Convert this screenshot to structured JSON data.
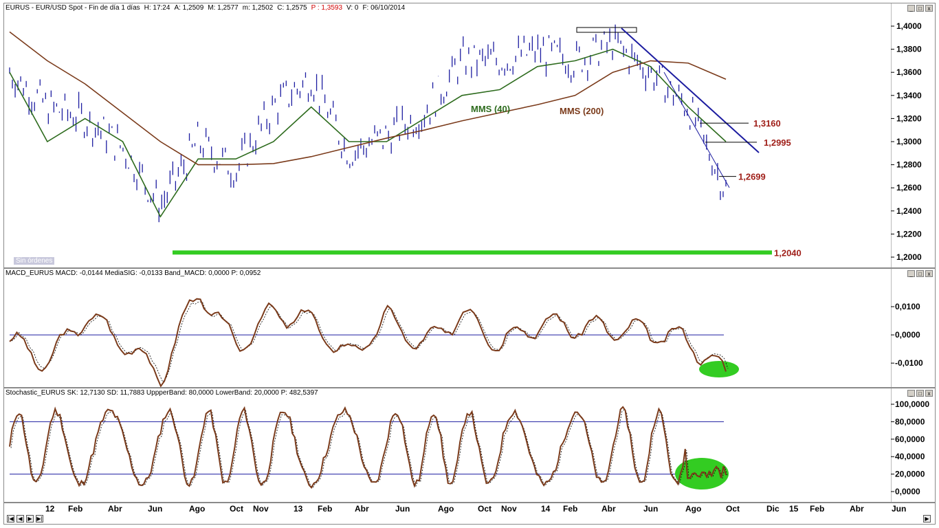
{
  "price_panel": {
    "header": [
      "EURUS - EUR/USD Spot - Fin de día 1 días",
      "H: 17:24",
      "A: 1,2509",
      "M: 1,2577",
      "m: 1,2502",
      "C: 1,2575"
    ],
    "header_p": "P : 1,3593",
    "header_tail": [
      "V: 0",
      "F: 06/10/2014"
    ],
    "labels": {
      "mms40": "MMS (40)",
      "mms200": "MMS (200)",
      "l1316": "1,3160",
      "l12995": "1,2995",
      "l12699": "1,2699",
      "l12040": "1,2040"
    },
    "status": "Sin órdenes",
    "yticks": [
      "1,4000",
      "1,3800",
      "1,3600",
      "1,3400",
      "1,3200",
      "1,3000",
      "1,2800",
      "1,2600",
      "1,2400",
      "1,2200",
      "1,2000"
    ]
  },
  "macd_panel": {
    "header": "MACD_EURUS  MACD: -0,0144  MediaSIG: -0,0133  Band_MACD: 0,0000  P: 0,0952",
    "yticks": [
      "0,0100",
      "0,0000",
      "-0,0100"
    ]
  },
  "stoch_panel": {
    "header": "Stochastic_EURUS  SK: 12,7130  SD: 11,7883  UppperBand: 80,0000  LowerBand: 20,0000  P: 482,5397",
    "yticks": [
      "100,0000",
      "80,0000",
      "60,0000",
      "40,0000",
      "20,0000",
      "0,0000"
    ]
  },
  "time_axis": [
    "12",
    "Feb",
    "Abr",
    "Jun",
    "Ago",
    "Oct",
    "Nov",
    "13",
    "Feb",
    "Abr",
    "Jun",
    "Ago",
    "Oct",
    "Nov",
    "14",
    "Feb",
    "Abr",
    "Jun",
    "Ago",
    "Oct",
    "Dic",
    "15",
    "Feb",
    "Abr",
    "Jun"
  ],
  "colors": {
    "price": "#1c1ca0",
    "mms40": "#2d6b1d",
    "mms200": "#7a3a1a",
    "macd": "#7a3a1a",
    "highlight": "#33cc22",
    "level": "#a0201a"
  },
  "chart_data": [
    {
      "type": "line",
      "title": "EURUS - EUR/USD Spot - Fin de día 1 días",
      "x": [
        "2012-01",
        "2012-02",
        "2012-04",
        "2012-06",
        "2012-08",
        "2012-10",
        "2012-11",
        "2013-01",
        "2013-02",
        "2013-04",
        "2013-06",
        "2013-08",
        "2013-10",
        "2013-11",
        "2014-01",
        "2014-02",
        "2014-04",
        "2014-06",
        "2014-08",
        "2014-10"
      ],
      "series": [
        {
          "name": "MMS (40)",
          "values": [
            1.36,
            1.3,
            1.32,
            1.3,
            1.235,
            1.285,
            1.285,
            1.3,
            1.33,
            1.3,
            1.3,
            1.32,
            1.34,
            1.345,
            1.365,
            1.37,
            1.38,
            1.365,
            1.33,
            1.3
          ]
        },
        {
          "name": "MMS (200)",
          "values": [
            1.395,
            1.37,
            1.35,
            1.325,
            1.3,
            1.28,
            1.28,
            1.281,
            1.287,
            1.295,
            1.303,
            1.31,
            1.318,
            1.325,
            1.332,
            1.34,
            1.36,
            1.37,
            1.368,
            1.354
          ]
        }
      ],
      "price": [
        1.36,
        1.33,
        1.32,
        1.295,
        1.245,
        1.3,
        1.275,
        1.33,
        1.355,
        1.29,
        1.305,
        1.325,
        1.37,
        1.37,
        1.378,
        1.37,
        1.385,
        1.36,
        1.33,
        1.258
      ],
      "levels": [
        1.316,
        1.2995,
        1.2699,
        1.204
      ],
      "ylim": [
        1.2,
        1.4
      ]
    },
    {
      "type": "line",
      "title": "MACD_EURUS",
      "series": [
        {
          "name": "MACD",
          "values": [
            -0.002,
            -0.01,
            0.007,
            -0.002,
            -0.015,
            0.016,
            -0.004,
            0.008,
            0.005,
            -0.008,
            0.006,
            -0.004,
            0.008,
            -0.003,
            0.004,
            0.003,
            0.002,
            0.001,
            -0.002,
            -0.014
          ]
        }
      ],
      "ylim": [
        -0.018,
        0.02
      ]
    },
    {
      "type": "line",
      "title": "Stochastic_EURUS",
      "series": [
        {
          "name": "SK",
          "values": [
            15,
            88,
            20,
            85,
            15,
            90,
            12,
            80,
            95,
            15,
            88,
            15,
            90,
            20,
            92,
            30,
            85,
            20,
            80,
            12.7
          ]
        }
      ],
      "ylim": [
        0,
        100
      ]
    }
  ]
}
